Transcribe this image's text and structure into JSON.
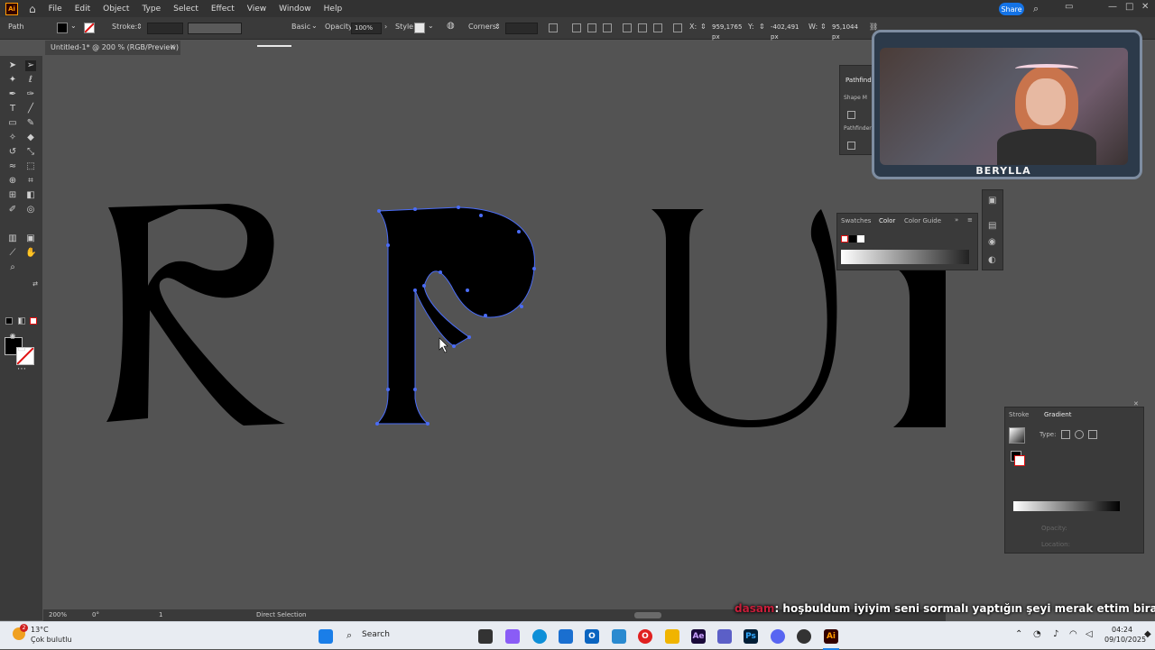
{
  "menu": {
    "app_logo": "Ai",
    "items": [
      "File",
      "Edit",
      "Object",
      "Type",
      "Select",
      "Effect",
      "View",
      "Window",
      "Help"
    ],
    "share_label": "Share"
  },
  "controlbar": {
    "selection_type": "Path",
    "stroke_label": "Stroke:",
    "brush_label": "Basic",
    "opacity_label": "Opacity:",
    "opacity_value": "100%",
    "style_label": "Style:",
    "corners_label": "Corners:",
    "x_label": "X:",
    "x_value": "959,1765 px",
    "y_label": "Y:",
    "y_value": "-402,491 px",
    "w_label": "W:",
    "w_value": "95,1044 px"
  },
  "document": {
    "tab_title": "Untitled-1* @ 200 % (RGB/Preview)",
    "close_glyph": "×"
  },
  "canvas": {
    "letters": [
      "R",
      "P",
      "U"
    ]
  },
  "pathfinder_panel": {
    "title": "Pathfinder",
    "shape_modes": "Shape M",
    "pathfinders": "Pathfinder"
  },
  "color_panel": {
    "tabs": [
      "Swatches",
      "Color",
      "Color Guide"
    ],
    "active_tab": "Color"
  },
  "gradient_panel": {
    "tabs": [
      "Stroke",
      "Gradient"
    ],
    "active_tab": "Gradient",
    "type_label": "Type:",
    "opacity_label": "Opacity:",
    "location_label": "Location:"
  },
  "statusbar": {
    "zoom": "200%",
    "rotation": "0°",
    "artboard": "1",
    "tool": "Direct Selection"
  },
  "stream": {
    "streamer_name": "BERYLLA",
    "chat_user": "dasam",
    "chat_message": ": hoşbuldum iyiyim seni sormalı yaptığın şeyi merak ettim biraz"
  },
  "taskbar": {
    "weather_temp": "13°C",
    "weather_desc": "Çok bulutlu",
    "weather_badge": "2",
    "search_label": "Search",
    "time": "04:24",
    "date": "09/10/2025"
  },
  "colors": {
    "accent": "#1473e6",
    "selection": "#4a6cf7",
    "canvas": "#535353",
    "panel": "#3a3a3a"
  }
}
